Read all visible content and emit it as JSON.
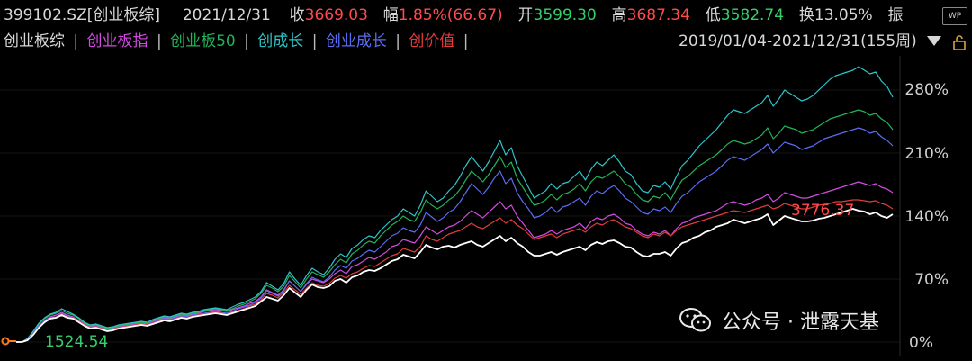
{
  "quote": {
    "code": "399102.SZ[创业板综]",
    "date": "2021/12/31",
    "close_label": "收",
    "close": "3669.03",
    "change_label": "幅",
    "change": "1.85%(66.67)",
    "open_label": "开",
    "open": "3599.30",
    "high_label": "高",
    "high": "3687.34",
    "low_label": "低",
    "low": "3582.74",
    "turnover_label": "换",
    "turnover": "13.05%",
    "amplitude_label": "振"
  },
  "legend": {
    "items": [
      {
        "label": "创业板综",
        "color": "#ffffff"
      },
      {
        "label": "创业板指",
        "color": "#d24be0"
      },
      {
        "label": "创业板50",
        "color": "#22b35a"
      },
      {
        "label": "创成长",
        "color": "#2fc3c8"
      },
      {
        "label": "创业成长",
        "color": "#5a6cf0"
      },
      {
        "label": "创价值",
        "color": "#e23b3b"
      }
    ],
    "separator": "|"
  },
  "range": "2019/01/04-2021/12/31(155周)",
  "toolbar": {
    "wp_label": "WP"
  },
  "y_axis": [
    "280%",
    "210%",
    "140%",
    "70%",
    "0%"
  ],
  "annotations": {
    "last_value": "3776.37",
    "base_value": "1524.54"
  },
  "watermark": {
    "text": "公众号 · 泄露天基",
    "icon": "wechat-icon"
  },
  "chart_data": {
    "type": "line",
    "x_start": "2019/01/04",
    "x_end": "2021/12/31",
    "ylim": [
      0,
      280
    ],
    "y_ticks": [
      "280%",
      "210%",
      "140%",
      "70%",
      "0%"
    ],
    "series": [
      {
        "name": "创业板综",
        "color": "#ffffff",
        "values": [
          0,
          0,
          2,
          8,
          16,
          22,
          26,
          27,
          30,
          27,
          26,
          22,
          18,
          15,
          16,
          14,
          12,
          13,
          15,
          16,
          17,
          18,
          19,
          18,
          20,
          22,
          24,
          23,
          25,
          27,
          26,
          28,
          29,
          30,
          31,
          32,
          31,
          30,
          32,
          34,
          36,
          38,
          40,
          45,
          50,
          48,
          46,
          52,
          60,
          55,
          50,
          58,
          64,
          61,
          60,
          62,
          68,
          70,
          66,
          72,
          74,
          78,
          80,
          79,
          82,
          86,
          90,
          92,
          97,
          95,
          93,
          100,
          108,
          105,
          103,
          106,
          107,
          105,
          108,
          110,
          112,
          108,
          106,
          110,
          114,
          118,
          112,
          116,
          110,
          106,
          100,
          96,
          96,
          98,
          100,
          97,
          100,
          102,
          104,
          106,
          102,
          108,
          111,
          109,
          112,
          113,
          110,
          106,
          105,
          100,
          96,
          95,
          98,
          98,
          100,
          96,
          104,
          110,
          112,
          116,
          118,
          122,
          124,
          128,
          130,
          132,
          136,
          134,
          132,
          134,
          136,
          138,
          142,
          130,
          135,
          140,
          138,
          136,
          134,
          134,
          135,
          137,
          138,
          140,
          142,
          144,
          146,
          148,
          146,
          145,
          142,
          144,
          140,
          138,
          142
        ]
      },
      {
        "name": "创业板指",
        "color": "#d24be0",
        "values": [
          0,
          0,
          3,
          10,
          18,
          24,
          28,
          30,
          33,
          30,
          28,
          24,
          20,
          17,
          18,
          16,
          14,
          15,
          17,
          18,
          19,
          20,
          21,
          20,
          23,
          25,
          27,
          26,
          28,
          30,
          29,
          31,
          32,
          34,
          35,
          36,
          35,
          34,
          36,
          38,
          40,
          43,
          45,
          50,
          58,
          55,
          52,
          58,
          68,
          62,
          56,
          64,
          70,
          68,
          66,
          70,
          76,
          80,
          76,
          84,
          86,
          90,
          94,
          92,
          96,
          100,
          106,
          108,
          114,
          112,
          110,
          118,
          128,
          124,
          120,
          124,
          128,
          130,
          134,
          140,
          146,
          142,
          138,
          144,
          150,
          156,
          148,
          152,
          140,
          132,
          124,
          116,
          118,
          120,
          124,
          120,
          124,
          126,
          128,
          132,
          126,
          134,
          138,
          136,
          140,
          142,
          138,
          132,
          130,
          124,
          120,
          118,
          122,
          120,
          124,
          118,
          126,
          132,
          134,
          138,
          140,
          142,
          144,
          146,
          150,
          154,
          156,
          154,
          152,
          154,
          158,
          160,
          164,
          156,
          160,
          166,
          164,
          162,
          160,
          160,
          162,
          164,
          166,
          168,
          170,
          172,
          174,
          176,
          178,
          176,
          174,
          176,
          172,
          170,
          166
        ]
      },
      {
        "name": "创业板50",
        "color": "#22b35a",
        "values": [
          0,
          0,
          3,
          11,
          20,
          26,
          30,
          32,
          35,
          32,
          30,
          26,
          21,
          18,
          19,
          17,
          15,
          16,
          18,
          19,
          20,
          21,
          22,
          21,
          24,
          26,
          28,
          27,
          29,
          31,
          30,
          32,
          33,
          35,
          36,
          37,
          36,
          35,
          37,
          40,
          42,
          45,
          48,
          54,
          63,
          60,
          56,
          62,
          74,
          67,
          60,
          70,
          78,
          75,
          72,
          78,
          86,
          92,
          88,
          98,
          102,
          108,
          112,
          110,
          118,
          124,
          130,
          134,
          140,
          136,
          134,
          144,
          158,
          152,
          148,
          152,
          158,
          162,
          170,
          180,
          190,
          184,
          178,
          186,
          196,
          206,
          194,
          200,
          182,
          172,
          162,
          152,
          154,
          158,
          164,
          158,
          164,
          166,
          170,
          176,
          168,
          178,
          184,
          182,
          186,
          190,
          184,
          176,
          172,
          164,
          158,
          156,
          162,
          160,
          166,
          158,
          170,
          180,
          184,
          190,
          196,
          200,
          204,
          208,
          214,
          220,
          224,
          222,
          220,
          222,
          226,
          230,
          238,
          226,
          232,
          240,
          238,
          236,
          232,
          234,
          236,
          240,
          244,
          248,
          250,
          252,
          254,
          256,
          258,
          256,
          252,
          254,
          248,
          244,
          236
        ]
      },
      {
        "name": "创成长",
        "color": "#2fc3c8",
        "values": [
          0,
          0,
          4,
          12,
          21,
          27,
          31,
          33,
          37,
          34,
          31,
          27,
          22,
          19,
          20,
          18,
          16,
          17,
          19,
          20,
          21,
          22,
          23,
          22,
          25,
          27,
          29,
          28,
          30,
          32,
          31,
          33,
          34,
          36,
          37,
          38,
          37,
          36,
          39,
          42,
          44,
          47,
          50,
          56,
          66,
          62,
          58,
          65,
          78,
          70,
          63,
          74,
          82,
          78,
          75,
          82,
          92,
          98,
          94,
          104,
          108,
          114,
          118,
          116,
          124,
          130,
          136,
          140,
          148,
          144,
          140,
          152,
          168,
          162,
          156,
          160,
          168,
          174,
          184,
          196,
          206,
          198,
          190,
          200,
          212,
          224,
          208,
          216,
          196,
          184,
          172,
          160,
          164,
          168,
          176,
          170,
          176,
          178,
          184,
          190,
          180,
          192,
          200,
          196,
          202,
          208,
          200,
          190,
          186,
          176,
          168,
          166,
          174,
          172,
          178,
          170,
          184,
          196,
          202,
          210,
          218,
          224,
          230,
          236,
          244,
          252,
          258,
          256,
          254,
          258,
          262,
          266,
          274,
          262,
          270,
          280,
          276,
          272,
          268,
          270,
          274,
          280,
          286,
          292,
          296,
          298,
          300,
          302,
          306,
          302,
          298,
          300,
          290,
          284,
          272
        ]
      },
      {
        "name": "创业成长",
        "color": "#5a6cf0",
        "values": [
          0,
          0,
          3,
          10,
          18,
          23,
          27,
          28,
          32,
          29,
          27,
          23,
          19,
          16,
          17,
          15,
          13,
          14,
          16,
          17,
          18,
          19,
          20,
          19,
          22,
          24,
          26,
          25,
          27,
          29,
          28,
          30,
          31,
          32,
          33,
          34,
          33,
          32,
          34,
          37,
          39,
          41,
          44,
          49,
          57,
          54,
          51,
          57,
          68,
          62,
          56,
          65,
          72,
          69,
          67,
          72,
          80,
          85,
          82,
          90,
          93,
          98,
          102,
          100,
          106,
          112,
          118,
          121,
          127,
          124,
          122,
          130,
          144,
          139,
          134,
          138,
          144,
          148,
          156,
          166,
          176,
          170,
          164,
          172,
          182,
          190,
          176,
          182,
          166,
          156,
          148,
          138,
          140,
          144,
          150,
          144,
          150,
          152,
          156,
          160,
          152,
          162,
          168,
          165,
          170,
          174,
          168,
          160,
          156,
          150,
          144,
          142,
          148,
          146,
          150,
          144,
          154,
          162,
          166,
          172,
          178,
          182,
          186,
          190,
          196,
          202,
          206,
          204,
          202,
          206,
          210,
          214,
          220,
          210,
          216,
          222,
          220,
          218,
          214,
          216,
          218,
          222,
          226,
          228,
          230,
          232,
          234,
          236,
          238,
          236,
          232,
          234,
          228,
          224,
          218
        ]
      },
      {
        "name": "创价值",
        "color": "#e23b3b",
        "values": [
          0,
          0,
          2,
          9,
          17,
          22,
          26,
          28,
          31,
          28,
          27,
          23,
          19,
          16,
          17,
          15,
          13,
          14,
          16,
          17,
          18,
          19,
          20,
          19,
          21,
          23,
          25,
          24,
          26,
          28,
          27,
          29,
          30,
          31,
          32,
          33,
          32,
          31,
          33,
          35,
          37,
          40,
          42,
          47,
          54,
          52,
          49,
          55,
          63,
          58,
          53,
          60,
          66,
          63,
          62,
          65,
          71,
          74,
          71,
          76,
          78,
          82,
          85,
          84,
          88,
          92,
          96,
          98,
          104,
          102,
          100,
          106,
          118,
          114,
          112,
          116,
          120,
          122,
          124,
          128,
          132,
          128,
          126,
          130,
          134,
          138,
          132,
          136,
          130,
          126,
          120,
          114,
          116,
          118,
          120,
          116,
          120,
          122,
          124,
          126,
          122,
          128,
          132,
          130,
          134,
          136,
          132,
          128,
          126,
          122,
          118,
          116,
          120,
          118,
          122,
          118,
          124,
          128,
          130,
          132,
          134,
          136,
          138,
          140,
          142,
          144,
          146,
          145,
          144,
          146,
          148,
          150,
          152,
          148,
          150,
          154,
          152,
          150,
          148,
          148,
          150,
          152,
          153,
          154,
          156,
          156,
          157,
          158,
          158,
          157,
          156,
          157,
          154,
          152,
          148
        ]
      }
    ]
  }
}
